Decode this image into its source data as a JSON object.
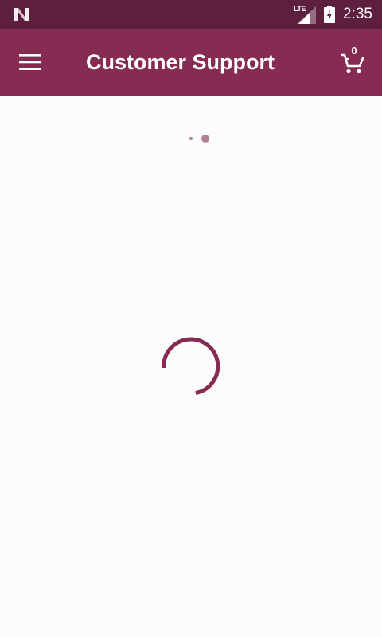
{
  "status_bar": {
    "network_label": "LTE",
    "time": "2:35",
    "icons": [
      "notification-n-icon",
      "signal-icon",
      "battery-charging-icon"
    ]
  },
  "app_bar": {
    "title": "Customer Support",
    "menu_icon": "hamburger-menu-icon",
    "cart_icon": "shopping-cart-icon",
    "cart_count": "0"
  },
  "content": {
    "state": "loading",
    "indicators": [
      "page-dots",
      "circular-progress-spinner"
    ]
  },
  "colors": {
    "status_bar": "#5e1e3e",
    "app_bar": "#862b52",
    "accent": "#862b52",
    "background": "#fdfcfd",
    "dots": "#b0809a"
  }
}
